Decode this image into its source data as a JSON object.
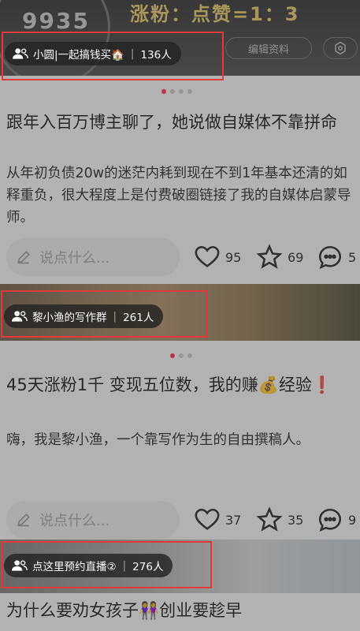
{
  "banner": {
    "number": "9935",
    "title": "涨粉：点赞=1：3",
    "edit_label": "编辑资料"
  },
  "cards": [
    {
      "group": {
        "name": "小圆|一起搞钱买🏠",
        "count": "136人"
      },
      "title": "跟年入百万博主聊了，她说做自媒体不靠拼命",
      "body": "从年初负债20w的迷茫内耗到现在不到1年基本还清的如释重负，很大程度上是付费破圈链接了我的自媒体启蒙导师。",
      "comment_placeholder": "说点什么...",
      "likes": "95",
      "stars": "69",
      "comments": "5"
    },
    {
      "group": {
        "name": "黎小渔的写作群",
        "count": "261人"
      },
      "title": "45天涨粉1千 变现五位数，我的赚💰经验❗",
      "body": "嗨，我是黎小渔，一个靠写作为生的自由撰稿人。",
      "comment_placeholder": "说点什么...",
      "likes": "37",
      "stars": "35",
      "comments": "9"
    },
    {
      "group": {
        "name": "点这里预约直播②",
        "count": "276人"
      },
      "title": "为什么要劝女孩子👭创业要趁早"
    }
  ],
  "colors": {
    "accent_dot": "#ff2442",
    "highlight_box": "#e23a3a"
  }
}
